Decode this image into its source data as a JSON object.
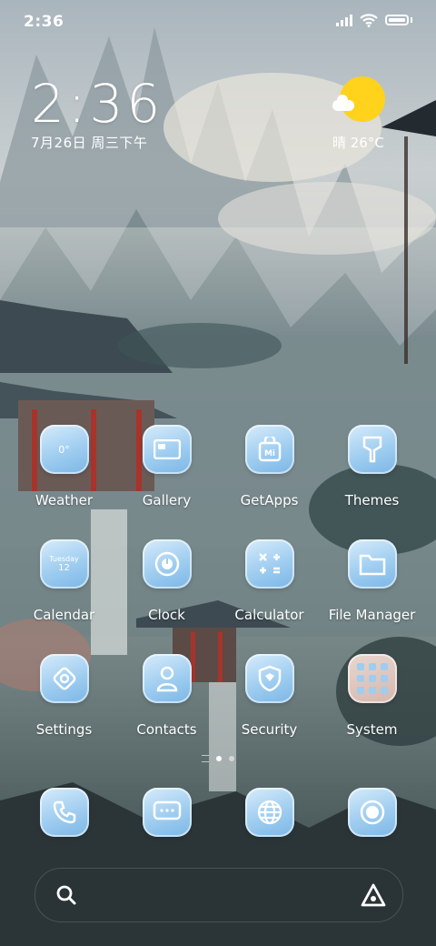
{
  "status_bar": {
    "time": "2:36",
    "icons": [
      "signal-icon",
      "wifi-icon",
      "battery-icon"
    ]
  },
  "clock_widget": {
    "time": "2:36",
    "date": "7月26日 周三下午"
  },
  "weather_widget": {
    "condition_icon": "sun-cloud-icon",
    "text": "晴 26°C"
  },
  "apps": [
    {
      "label": "Weather",
      "icon": "weather-icon",
      "icon_text": "0°"
    },
    {
      "label": "Gallery",
      "icon": "gallery-icon"
    },
    {
      "label": "GetApps",
      "icon": "getapps-icon",
      "icon_text": "Mi"
    },
    {
      "label": "Themes",
      "icon": "themes-icon"
    },
    {
      "label": "Calendar",
      "icon": "calendar-icon",
      "icon_day": "Tuesday",
      "icon_date": "12"
    },
    {
      "label": "Clock",
      "icon": "clock-icon"
    },
    {
      "label": "Calculator",
      "icon": "calculator-icon"
    },
    {
      "label": "File Manager",
      "icon": "folder-icon"
    },
    {
      "label": "Settings",
      "icon": "settings-icon"
    },
    {
      "label": "Contacts",
      "icon": "contacts-icon"
    },
    {
      "label": "Security",
      "icon": "shield-icon"
    },
    {
      "label": "System",
      "icon": "folder-grid-icon"
    }
  ],
  "page_indicator": {
    "pages": 2,
    "active": 0
  },
  "dock": [
    {
      "name": "phone",
      "icon": "phone-icon"
    },
    {
      "name": "messages",
      "icon": "messages-icon"
    },
    {
      "name": "browser",
      "icon": "globe-icon"
    },
    {
      "name": "camera",
      "icon": "camera-icon"
    }
  ],
  "search_bar": {
    "left_icon": "search-icon",
    "right_icon": "assistant-icon"
  },
  "colors": {
    "icon_blue": "#9fcdf0",
    "sun": "#ffd21c"
  }
}
